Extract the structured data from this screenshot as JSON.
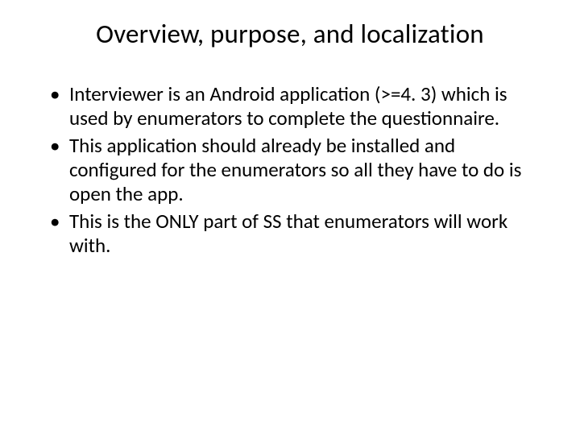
{
  "slide": {
    "title": "Overview, purpose, and localization",
    "bullets": [
      "Interviewer is an Android application (>=4. 3) which is used by enumerators to complete the questionnaire.",
      "This application should already be installed and configured for the enumerators so all they have to do is open the app.",
      "This is the ONLY part of SS that enumerators will work with."
    ]
  }
}
